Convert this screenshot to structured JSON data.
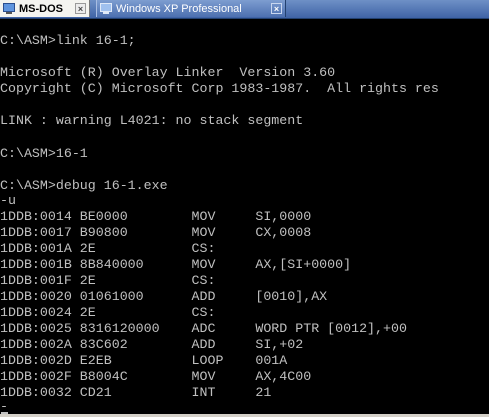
{
  "tabs": [
    {
      "label": "MS-DOS",
      "icon": "monitor-icon",
      "active": true
    },
    {
      "label": "Windows XP Professional",
      "icon": "monitor-icon",
      "active": false
    }
  ],
  "tab_close_glyph": "×",
  "console": {
    "lines": [
      "C:\\ASM>link 16-1;",
      "Microsoft (R) Overlay Linker  Version 3.60",
      "Copyright (C) Microsoft Corp 1983-1987.  All rights res",
      "LINK : warning L4021: no stack segment",
      "C:\\ASM>16-1",
      "C:\\ASM>debug 16-1.exe",
      "-u",
      "1DDB:0014 BE0000        MOV     SI,0000",
      "1DDB:0017 B90800        MOV     CX,0008",
      "1DDB:001A 2E            CS:",
      "1DDB:001B 8B840000      MOV     AX,[SI+0000]",
      "1DDB:001F 2E            CS:",
      "1DDB:0020 01061000      ADD     [0010],AX",
      "1DDB:0024 2E            CS:",
      "1DDB:0025 8316120000    ADC     WORD PTR [0012],+00",
      "1DDB:002A 83C602        ADD     SI,+02",
      "1DDB:002D E2EB          LOOP    001A",
      "1DDB:002F B8004C        MOV     AX,4C00",
      "1DDB:0032 CD21          INT     21",
      "-"
    ]
  },
  "colors": {
    "console_bg": "#000000",
    "console_text": "#c0c0c0",
    "tabstrip": "#4a6db0"
  }
}
